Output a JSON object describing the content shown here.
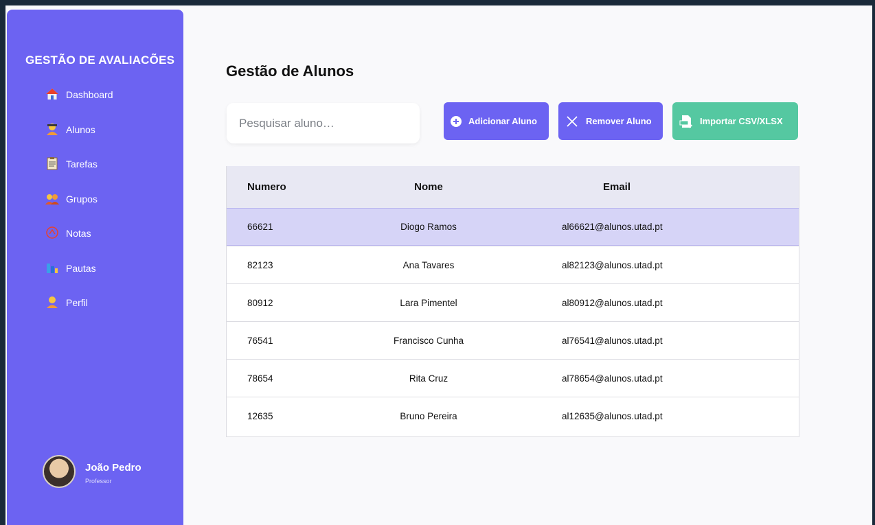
{
  "sidebar": {
    "brand": "GESTÃO DE AVALIACÕES",
    "items": [
      {
        "label": "Dashboard",
        "icon": "house-icon"
      },
      {
        "label": "Alunos",
        "icon": "student-icon"
      },
      {
        "label": "Tarefas",
        "icon": "clipboard-icon"
      },
      {
        "label": "Grupos",
        "icon": "group-icon"
      },
      {
        "label": "Notas",
        "icon": "grade-icon"
      },
      {
        "label": "Pautas",
        "icon": "bar-chart-icon"
      },
      {
        "label": "Perfil",
        "icon": "person-icon"
      }
    ],
    "profile": {
      "name": "João Pedro",
      "role": "Professor"
    }
  },
  "main": {
    "title": "Gestão de Alunos",
    "search": {
      "placeholder": "Pesquisar aluno…",
      "value": ""
    },
    "buttons": {
      "add": "Adicionar Aluno",
      "remove": "Remover Aluno",
      "import": "Importar CSV/XLSX"
    },
    "table": {
      "headers": [
        "Numero",
        "Nome",
        "Email"
      ],
      "rows": [
        [
          "66621",
          "Diogo Ramos",
          "al66621@alunos.utad.pt"
        ],
        [
          "82123",
          "Ana Tavares",
          "al82123@alunos.utad.pt"
        ],
        [
          "80912",
          "Lara Pimentel",
          "al80912@alunos.utad.pt"
        ],
        [
          "76541",
          "Francisco Cunha",
          "al76541@alunos.utad.pt"
        ],
        [
          "78654",
          "Rita Cruz",
          "al78654@alunos.utad.pt"
        ],
        [
          "12635",
          "Bruno Pereira",
          "al12635@alunos.utad.pt"
        ]
      ],
      "selected_row": 0
    }
  },
  "colors": {
    "accent": "#6c63f2",
    "import": "#55c8a1",
    "selected_row": "#d6d4f7",
    "header_bg": "#e8e8f3"
  }
}
